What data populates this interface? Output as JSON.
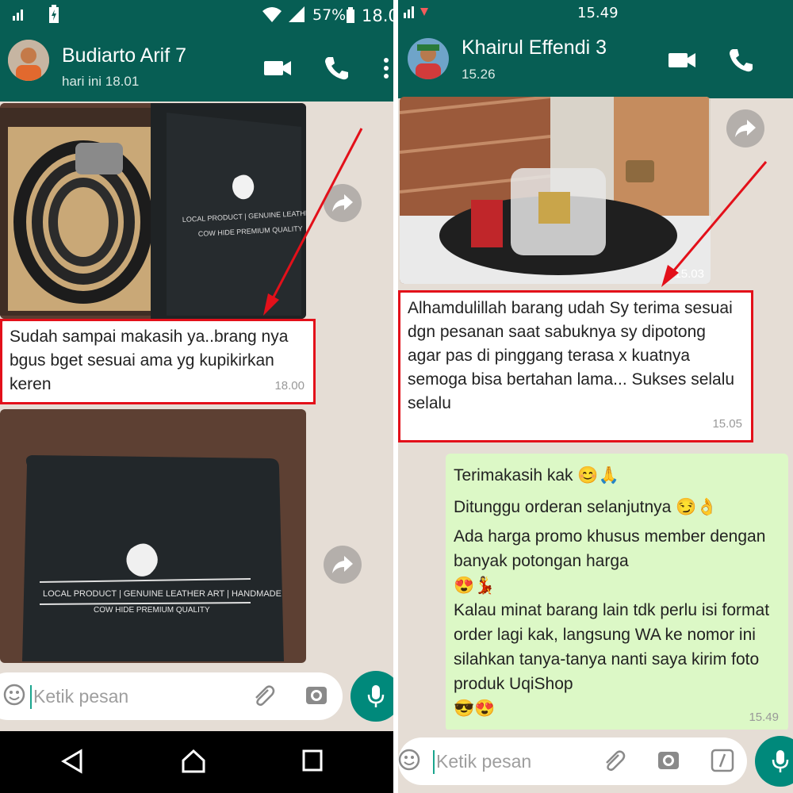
{
  "left": {
    "status": {
      "signal": "📶",
      "battery_pct": "57%",
      "time": "18.0"
    },
    "contact": {
      "name": "Budiarto Arif 7",
      "last_seen": "hari ini 18.01"
    },
    "box_text": {
      "line1": "LOCAL PRODUCT | GENUINE LEATHER ART | HANDMADE",
      "line2": "COW HIDE PREMIUM QUALITY"
    },
    "message": {
      "text": "Sudah sampai makasih ya..brang nya bgus bget sesuai ama yg kupikirkan keren",
      "time": "18.00"
    },
    "input": {
      "placeholder": "Ketik pesan"
    }
  },
  "right": {
    "status": {
      "time": "15.49"
    },
    "contact": {
      "name": "Khairul Effendi 3",
      "last_seen": "15.26"
    },
    "photo_time": "15.03",
    "message": {
      "text": "Alhamdulillah barang udah Sy terima sesuai dgn pesanan saat sabuknya sy dipotong agar pas di pinggang terasa x kuatnya semoga bisa bertahan lama...  Sukses selalu selalu",
      "time": "15.05"
    },
    "reply": {
      "line1": "Terimakasih kak 😊🙏",
      "line2": "Ditunggu orderan selanjutnya 😏👌",
      "line3": "Ada harga promo khusus member dengan banyak potongan harga",
      "line4": "😍💃",
      "line5": "Kalau minat barang lain tdk perlu isi format order lagi kak, langsung WA ke nomor ini silahkan tanya-tanya nanti saya kirim foto produk UqiShop",
      "line6": "😎😍",
      "time": "15.49"
    },
    "input": {
      "placeholder": "Ketik pesan"
    }
  },
  "colors": {
    "header": "#075e54",
    "chat_bg": "#e5ddd5",
    "outgoing": "#dcf8c6",
    "highlight": "#e3101a",
    "mic": "#00897b"
  }
}
